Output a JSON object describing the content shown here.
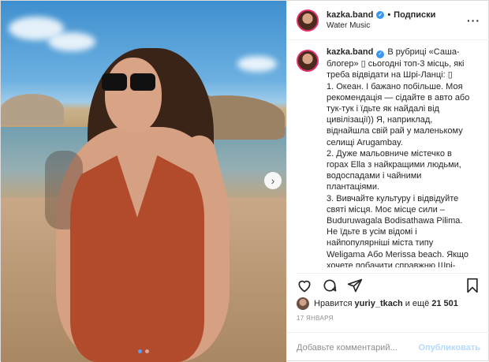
{
  "post": {
    "username": "kazka.band",
    "follow_label": "Подписки",
    "location": "Water Music",
    "caption_lines": [
      "В рубриці «Саша-",
      "блогер» ▯ сьогодні топ-3 місць, які",
      "треба відвідати на Шрі-Ланці: ▯",
      "1. Океан. І бажано побільше. Моя",
      "рекомендація — сідайте в авто або",
      "тук-тук і їдьте як найдалі від",
      "цивілізації)) Я, наприклад,",
      "віднайшла свій рай у маленькому",
      "селищі Arugambay.",
      "2. Дуже мальовниче містечко в",
      "горах Ella з найкращими людьми,",
      "водоспадами і чайними",
      "плантаціями.",
      "3. Вивчайте культуру і відвідуйте",
      "святі місця. Моє місце сили –",
      "Buduruwagala Bodisathawa Pilima.",
      "Не їдьте в усім відомі і",
      "найпопулярніші міста типу",
      "Weligama Або Merissa beach. Якщо",
      "хочете побачити справжню Шрі-"
    ],
    "likes_prefix": "Нравится",
    "liker": "yuriy_tkach",
    "likes_mid": "и ещё",
    "likes_count": "21 501",
    "date": "17 ЯНВАРЯ",
    "comment_placeholder": "Добавьте комментарий...",
    "publish_label": "Опубликовать",
    "icons": [
      "heart-icon",
      "comment-icon",
      "share-icon",
      "bookmark-icon",
      "chevron-right-icon",
      "more-icon"
    ],
    "colors": {
      "verified": "#3897f0",
      "publish": "#b3dbff",
      "active_dot": "#4da3ff"
    }
  }
}
